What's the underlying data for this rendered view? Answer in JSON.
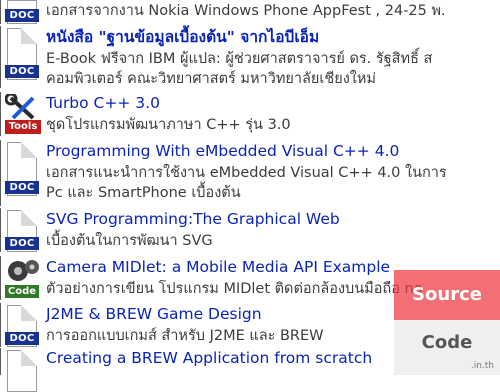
{
  "items": [
    {
      "badge": "DOC",
      "icon": "document-icon",
      "title": "",
      "desc": "เอกสารจากงาน Nokia Windows Phone AppFest , 24-25 พ."
    },
    {
      "badge": "DOC",
      "icon": "document-icon",
      "title": "หนังสือ \"ฐานข้อมูลเบื้องต้น\" จากไอบีเอ็ม",
      "desc": "E-Book ฟรีจาก IBM ผู้แปล: ผู้ช่วยศาสตราจารย์ ดร. รัฐสิทธิ์ ส",
      "desc2": "คอมพิวเตอร์ คณะวิทยาศาสตร์ มหาวิทยาลัยเชียงใหม่"
    },
    {
      "badge": "Tools",
      "icon": "wrench-screwdriver-icon",
      "title": "Turbo C++ 3.0",
      "desc": "ชุดโปรแกรมพัฒนาภาษา C++ รุ่น 3.0"
    },
    {
      "badge": "DOC",
      "icon": "document-icon",
      "title": "Programming With eMbedded Visual C++ 4.0",
      "desc": "เอกสารแนะนำการใช้งาน eMbedded Visual C++ 4.0 ในการ",
      "desc2": "Pc และ SmartPhone เบื้องต้น"
    },
    {
      "badge": "DOC",
      "icon": "document-icon",
      "title": "SVG Programming:The Graphical Web",
      "desc": "เบื้องต้นในการพัฒนา SVG"
    },
    {
      "badge": "Code",
      "icon": "gears-icon",
      "title": "Camera MIDlet: a Mobile Media API Example",
      "desc": "ตัวอย่างการเขียน โปรแกรม MIDlet ติดต่อกล้องบนมือถือ no"
    },
    {
      "badge": "DOC",
      "icon": "document-icon",
      "title": "J2ME & BREW Game Design",
      "desc": "การออกแบบเกมส์ สำหรับ J2ME และ BREW"
    },
    {
      "badge": "DOC",
      "icon": "document-icon",
      "title": "Creating a BREW Application from scratch",
      "desc": ""
    }
  ],
  "watermark": {
    "source": "Source",
    "code": "Code",
    "domain": ".in.th"
  }
}
